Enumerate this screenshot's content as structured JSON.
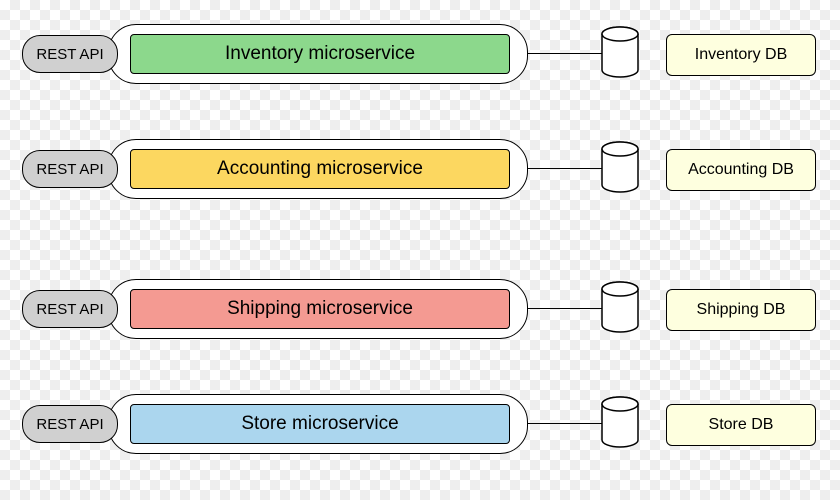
{
  "rows": [
    {
      "api_label": "REST API",
      "service_label": "Inventory microservice",
      "db_label": "Inventory DB",
      "color": "#8cd88c"
    },
    {
      "api_label": "REST API",
      "service_label": "Accounting microservice",
      "db_label": "Accounting DB",
      "color": "#fcd760"
    },
    {
      "api_label": "REST API",
      "service_label": "Shipping microservice",
      "db_label": "Shipping DB",
      "color": "#f49a92"
    },
    {
      "api_label": "REST API",
      "service_label": "Store microservice",
      "db_label": "Store DB",
      "color": "#abd6ee"
    }
  ]
}
